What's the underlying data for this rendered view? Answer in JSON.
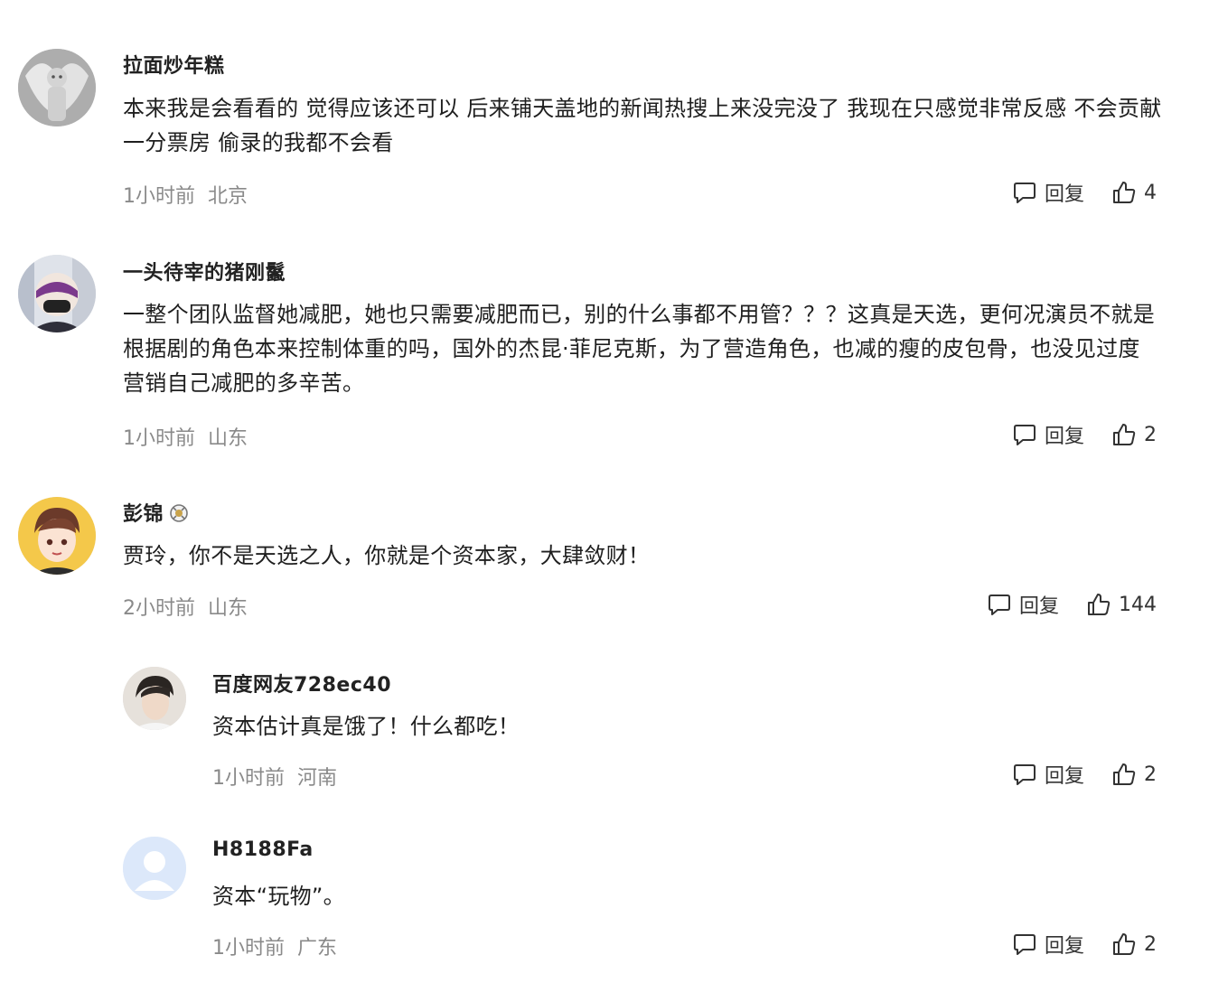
{
  "action_labels": {
    "reply": "回复"
  },
  "comments": [
    {
      "username": "拉面炒年糕",
      "text": "本来我是会看看的 觉得应该还可以 后来铺天盖地的新闻热搜上来没完没了 我现在只感觉非常反感 不会贡献一分票房 偷录的我都不会看",
      "time": "1小时前",
      "location": "北京",
      "likes": "4"
    },
    {
      "username": "一头待宰的猪刚鬣",
      "text": "一整个团队监督她减肥，她也只需要减肥而已，别的什么事都不用管？？？这真是天选，更何况演员不就是根据剧的角色本来控制体重的吗，国外的杰昆·菲尼克斯，为了营造角色，也减的瘦的皮包骨，也没见过度营销自己减肥的多辛苦。",
      "time": "1小时前",
      "location": "山东",
      "likes": "2"
    },
    {
      "username": "彭锦",
      "text": "贾玲，你不是天选之人，你就是个资本家，大肆敛财！",
      "time": "2小时前",
      "location": "山东",
      "likes": "144"
    },
    {
      "username": "百度网友728ec40",
      "text": "资本估计真是饿了！什么都吃！",
      "time": "1小时前",
      "location": "河南",
      "likes": "2"
    },
    {
      "username": "H8188Fa",
      "text": "资本“玩物”。",
      "time": "1小时前",
      "location": "广东",
      "likes": "2"
    }
  ]
}
